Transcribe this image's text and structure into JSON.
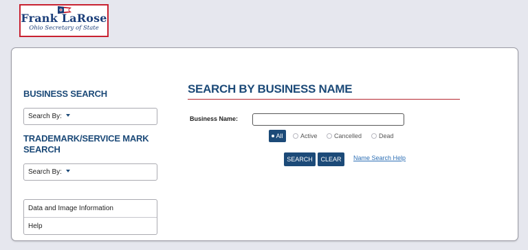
{
  "logo": {
    "name": "Frank LaRose",
    "subtitle": "Ohio Secretary of State"
  },
  "sidebar": {
    "business_search_heading": "BUSINESS SEARCH",
    "business_search_select": "Search By:",
    "trademark_heading_line1": "TRADEMARK/SERVICE MARK",
    "trademark_heading_line2": "SEARCH",
    "trademark_search_select": "Search By:",
    "links": [
      {
        "label": "Data and Image Information"
      },
      {
        "label": "Help"
      }
    ]
  },
  "main": {
    "title": "SEARCH BY BUSINESS NAME",
    "business_name_label": "Business Name:",
    "business_name_value": "",
    "status_filter": {
      "selected": "All",
      "options": [
        "All",
        "Active",
        "Cancelled",
        "Dead"
      ]
    },
    "search_label": "SEARCH",
    "clear_label": "CLEAR",
    "help_link": "Name Search Help"
  },
  "colors": {
    "brand_blue": "#1c4a78",
    "accent_red": "#b5262f",
    "link_blue": "#2d6fb5",
    "page_bg": "#e6e7ee"
  }
}
